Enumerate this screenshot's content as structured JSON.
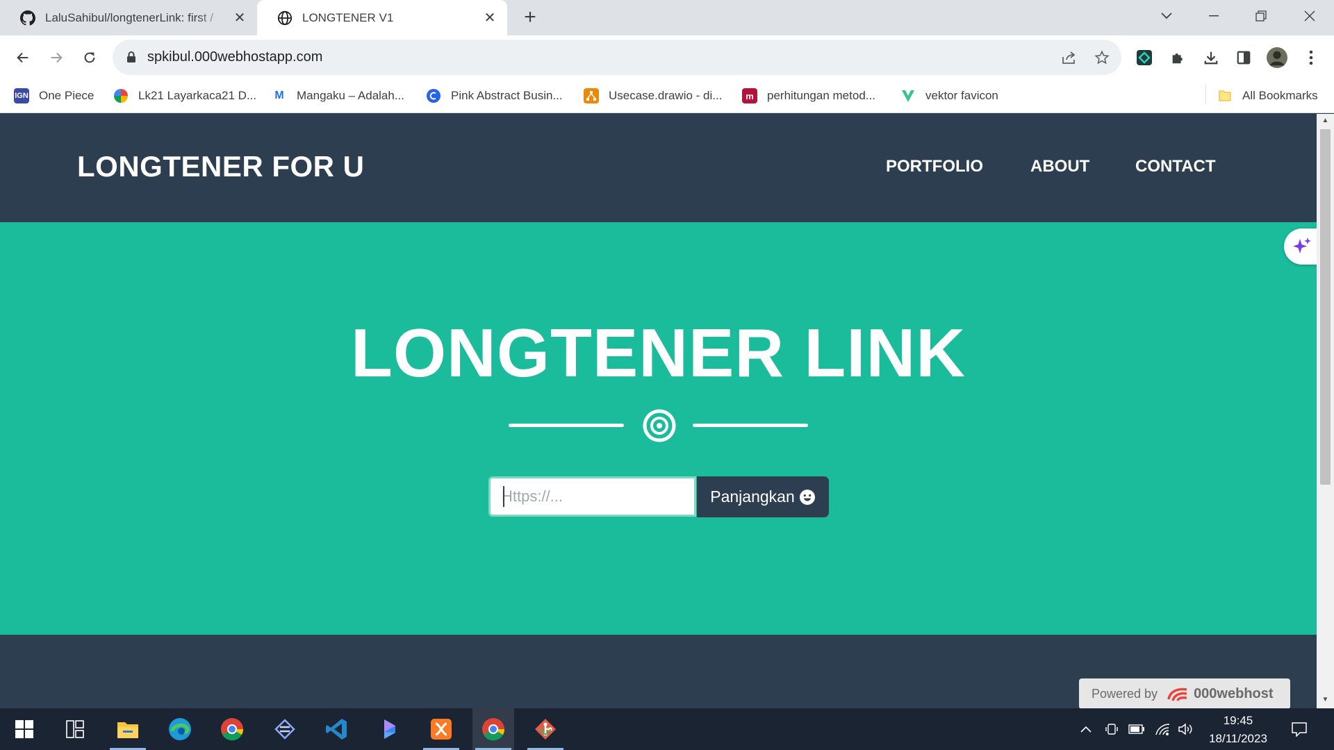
{
  "browser": {
    "tabs": [
      {
        "title": "LaluSahibul/longtenerLink: first /",
        "active": false
      },
      {
        "title": "LONGTENER V1",
        "active": true
      }
    ],
    "url": "spkibul.000webhostapp.com",
    "bookmarks": [
      {
        "label": "One Piece",
        "color": "#3b4aa8"
      },
      {
        "label": "Lk21 Layarkaca21 D...",
        "color": "#e8453c"
      },
      {
        "label": "Mangaku – Adalah...",
        "color": "#1a73e8"
      },
      {
        "label": "Pink Abstract Busin...",
        "color": "#2563eb"
      },
      {
        "label": "Usecase.drawio - di...",
        "color": "#f08705"
      },
      {
        "label": "perhitungan metod...",
        "color": "#b3123a"
      },
      {
        "label": "vektor favicon",
        "color": "#34c38f"
      }
    ],
    "all_bookmarks_label": "All Bookmarks"
  },
  "site": {
    "brand": "LONGTENER FOR U",
    "nav": [
      "PORTFOLIO",
      "ABOUT",
      "CONTACT"
    ],
    "headline": "LONGTENER LINK",
    "input_placeholder": "Https://...",
    "button_label": "Panjangkan",
    "colors": {
      "navbar": "#2c3e50",
      "masthead": "#1abc9c"
    }
  },
  "powered_by": {
    "label": "Powered by",
    "brand": "000webhost"
  },
  "taskbar": {
    "apps": [
      "start",
      "task-view",
      "file-explorer",
      "edge",
      "chrome",
      "visual-studio",
      "vscode",
      "copilot",
      "xampp",
      "chrome-active",
      "git"
    ],
    "time": "19:45",
    "date": "18/11/2023"
  }
}
